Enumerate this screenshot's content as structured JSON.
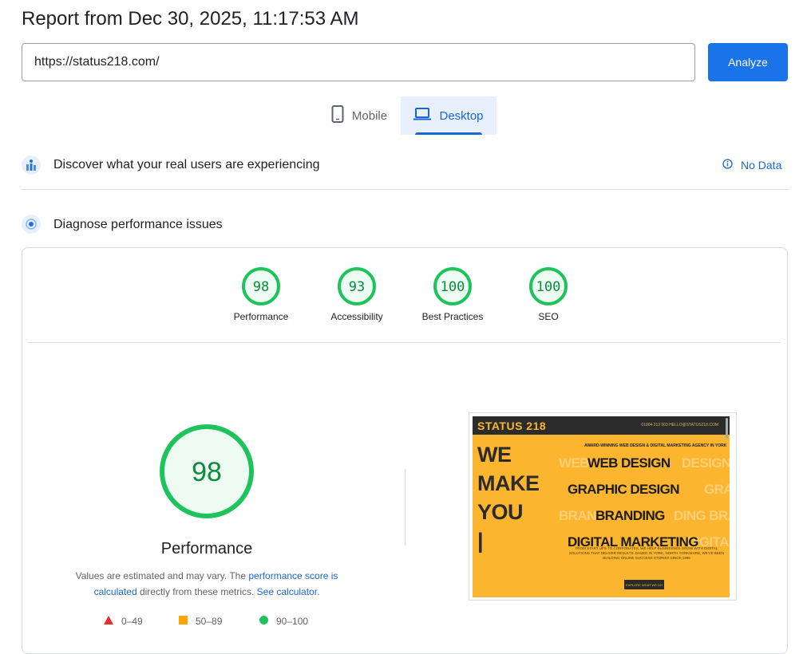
{
  "header": {
    "title": "Report from Dec 30, 2025, 11:17:53 AM"
  },
  "url_bar": {
    "value": "https://status218.com/",
    "analyze_label": "Analyze"
  },
  "tabs": [
    {
      "label": "Mobile",
      "icon": "smartphone-icon",
      "selected": false
    },
    {
      "label": "Desktop",
      "icon": "laptop-icon",
      "selected": true
    }
  ],
  "field_data": {
    "title": "Discover what your real users are experiencing",
    "status": "No Data",
    "icon": "users-chart-icon"
  },
  "diagnose": {
    "title": "Diagnose performance issues",
    "icon": "speed-target-icon"
  },
  "scores": [
    {
      "label": "Performance",
      "value": 98
    },
    {
      "label": "Accessibility",
      "value": 93
    },
    {
      "label": "Best Practices",
      "value": 100
    },
    {
      "label": "SEO",
      "value": 100
    }
  ],
  "main_score": {
    "value": "98",
    "label": "Performance"
  },
  "note": {
    "text1": "Values are estimated and may vary. The ",
    "link1": "performance score is calculated",
    "text2": " directly from these metrics. ",
    "link2": "See calculator",
    "text3": "."
  },
  "legend": [
    {
      "range": "0–49",
      "shape": "triangle",
      "color": "#e52f2f"
    },
    {
      "range": "50–89",
      "shape": "square",
      "color": "#ffa400"
    },
    {
      "range": "90–100",
      "shape": "circle",
      "color": "#1ec45b"
    }
  ],
  "colors": {
    "accent": "#1a73e8",
    "pass": "#1ec45b",
    "pass_bg": "#eefbf3",
    "pass_text": "#0c8a3e"
  },
  "screenshot": {
    "logo": "STATUS 218",
    "contact": "01904 213 903    HELLO@STATUS218.COM",
    "tagline": "AWARD-WINNING WEB DESIGN & DIGITAL MARKETING AGENCY IN YORK",
    "hero": [
      "WE",
      "MAKE",
      "YOU",
      "|"
    ],
    "services": [
      "WEB DESIGN",
      "GRAPHIC DESIGN",
      "BRANDING",
      "DIGITAL MARKETING"
    ],
    "description": "FROM START UPS TO CORPORATES, WE HELP BUSINESSES GROW WITH DIGITAL SOLUTIONS THAT DELIVER RESULTS. BASED IN YORK, NORTH YORKSHIRE, WE'VE BEEN BUILDING ONLINE SUCCESS STORIES SINCE 1996",
    "button": "EXPLORE WHAT WE DO"
  }
}
